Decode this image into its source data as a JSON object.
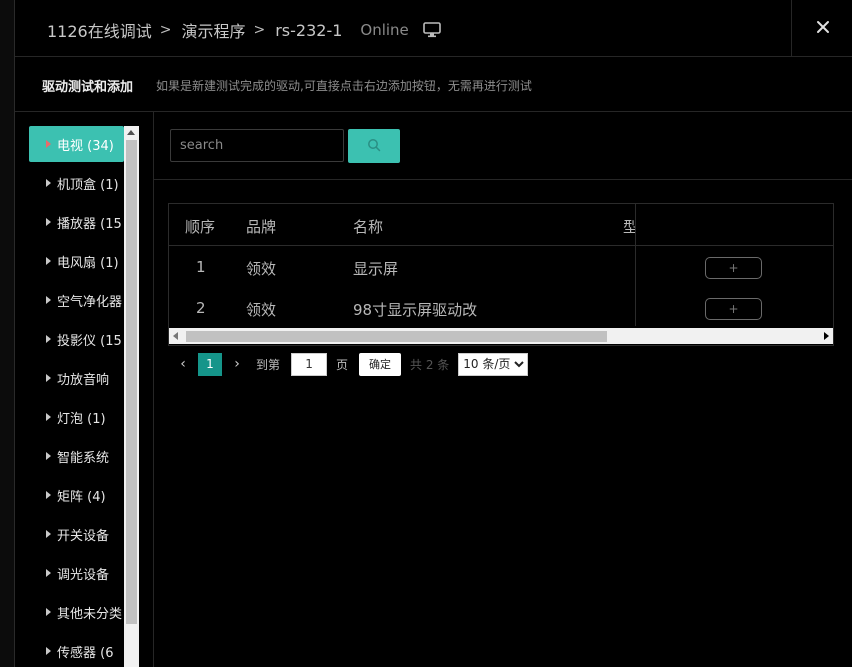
{
  "header": {
    "breadcrumb": [
      "1126在线调试",
      "演示程序",
      "rs-232-1"
    ],
    "separator": ">",
    "status": "Online",
    "close_label": "✕"
  },
  "desc": {
    "title": "驱动测试和添加",
    "text": "如果是新建测试完成的驱动,可直接点击右边添加按钮，无需再进行测试"
  },
  "sidebar": {
    "items": [
      {
        "label": "电视 (34)",
        "active": true
      },
      {
        "label": "机顶盒 (1)"
      },
      {
        "label": "播放器 (15"
      },
      {
        "label": "电风扇 (1)"
      },
      {
        "label": "空气净化器"
      },
      {
        "label": "投影仪 (15"
      },
      {
        "label": "功放音响"
      },
      {
        "label": "灯泡 (1)"
      },
      {
        "label": "智能系统"
      },
      {
        "label": "矩阵 (4)"
      },
      {
        "label": "开关设备"
      },
      {
        "label": "调光设备"
      },
      {
        "label": "其他未分类"
      },
      {
        "label": "传感器 (6"
      }
    ]
  },
  "search": {
    "placeholder": "search",
    "value": ""
  },
  "table": {
    "headers": [
      "顺序",
      "品牌",
      "名称",
      "型"
    ],
    "rows": [
      {
        "order": "1",
        "brand": "领效",
        "name": "显示屏",
        "action": "+"
      },
      {
        "order": "2",
        "brand": "领效",
        "name": "98寸显示屏驱动改",
        "action": "+"
      }
    ]
  },
  "pagination": {
    "prev": "‹",
    "next": "›",
    "current_page": "1",
    "goto_label": "到第",
    "goto_value": "1",
    "page_suffix": "页",
    "confirm_label": "确定",
    "total_label": "共 2 条",
    "page_size": "10 条/页"
  },
  "colors": {
    "accent": "#3cc1b1",
    "pager_active": "#15958a",
    "background": "#000000"
  }
}
